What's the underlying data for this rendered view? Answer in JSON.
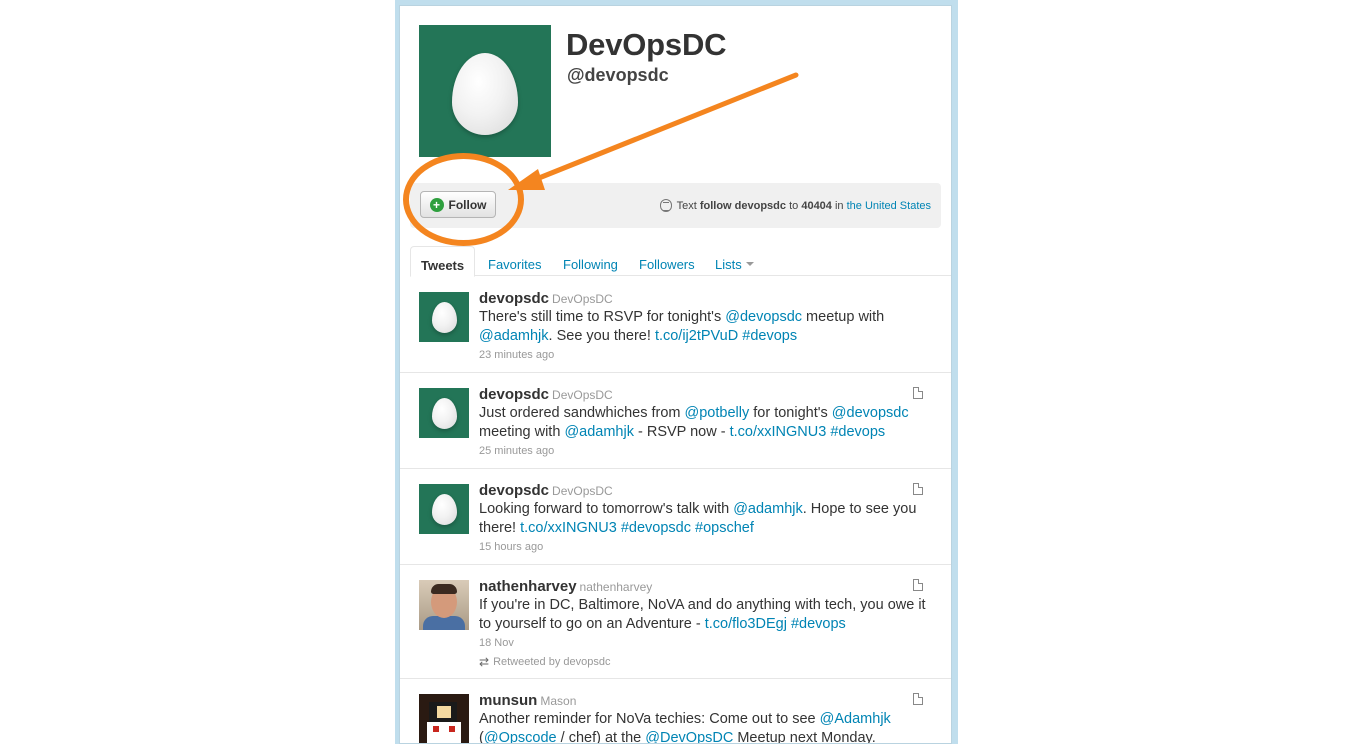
{
  "profile": {
    "name": "DevOpsDC",
    "handle": "@devopsdc"
  },
  "actions": {
    "follow_label": "Follow",
    "sms_prefix": "Text",
    "sms_command": "follow devopsdc",
    "sms_to": "to",
    "sms_number": "40404",
    "sms_in": "in",
    "sms_country": "the United States"
  },
  "tabs": [
    {
      "label": "Tweets",
      "active": true
    },
    {
      "label": "Favorites"
    },
    {
      "label": "Following"
    },
    {
      "label": "Followers"
    },
    {
      "label": "Lists"
    }
  ],
  "tweets": [
    {
      "screen_name": "devopsdc",
      "full_name": "DevOpsDC",
      "parts": [
        "There's still time to RSVP for tonight's ",
        "@devopsdc",
        " meetup with ",
        "@adamhjk",
        ". See you there! ",
        "t.co/ij2tPVuD",
        " ",
        "#devops"
      ],
      "time": "23 minutes ago"
    },
    {
      "screen_name": "devopsdc",
      "full_name": "DevOpsDC",
      "parts": [
        "Just ordered sandwhiches from ",
        "@potbelly",
        " for tonight's ",
        "@devopsdc",
        " meeting with ",
        "@adamhjk",
        " - RSVP now - ",
        "t.co/xxINGNU3",
        " ",
        "#devops"
      ],
      "time": "25 minutes ago"
    },
    {
      "screen_name": "devopsdc",
      "full_name": "DevOpsDC",
      "parts": [
        "Looking forward to tomorrow's talk with ",
        "@adamhjk",
        ". Hope to see you there! ",
        "t.co/xxINGNU3",
        " ",
        "#devopsdc",
        " ",
        "#opschef"
      ],
      "time": "15 hours ago"
    },
    {
      "screen_name": "nathenharvey",
      "full_name": "nathenharvey",
      "parts": [
        "If you're in DC, Baltimore, NoVA and do anything with tech, you owe it to yourself to go on an Adventure - ",
        "t.co/flo3DEgj",
        " ",
        "#devops"
      ],
      "time": "18 Nov",
      "retweeted_by": "Retweeted by devopsdc"
    },
    {
      "screen_name": "munsun",
      "full_name": "Mason",
      "parts": [
        "Another reminder for NoVa techies: Come out to see ",
        "@Adamhjk",
        " (",
        "@Opscode",
        " / chef) at the ",
        "@DevOpsDC",
        " Meetup next Monday."
      ]
    }
  ],
  "colors": {
    "link": "#0084b4",
    "annotation": "#f4851f",
    "egg_background": "#237557"
  }
}
